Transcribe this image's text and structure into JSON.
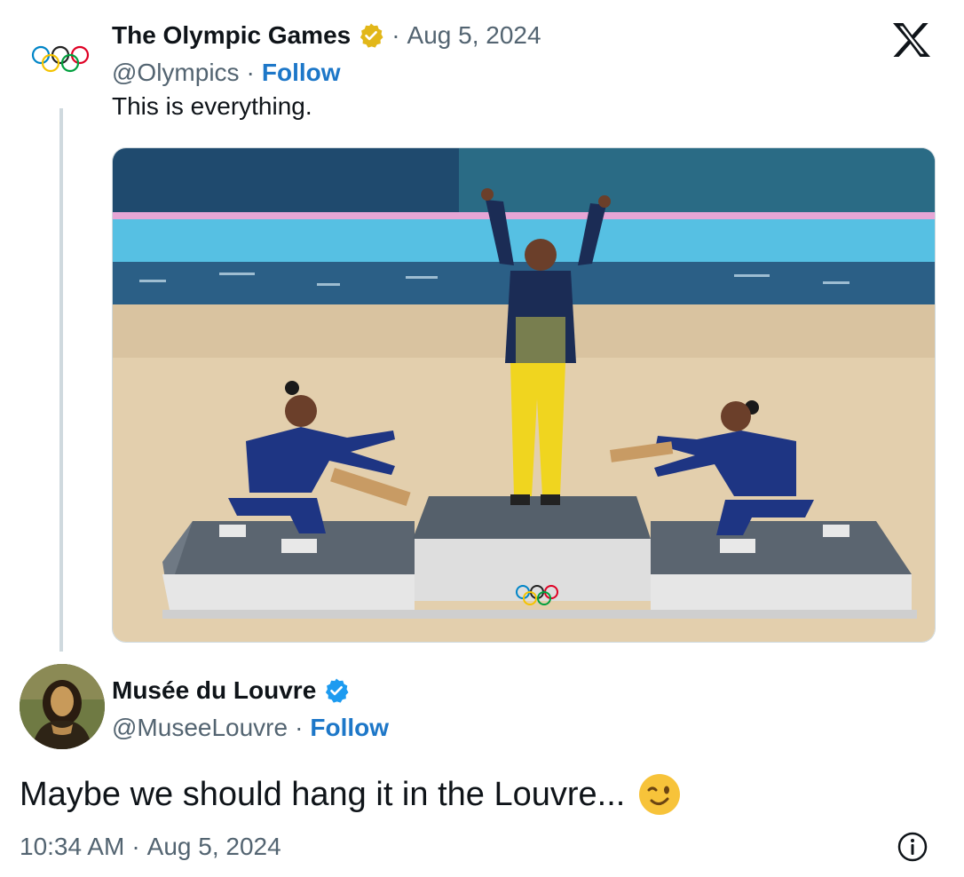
{
  "first_tweet": {
    "author_name": "The Olympic Games",
    "handle": "@Olympics",
    "separator": "·",
    "date": "Aug 5, 2024",
    "follow_label": "Follow",
    "text": "This is everything.",
    "verified_badge_color": "#e2b719",
    "avatar_icon": "olympic-rings-icon",
    "media_icon": "photo"
  },
  "reply_tweet": {
    "author_name": "Musée du Louvre",
    "handle": "@MuseeLouvre",
    "separator": "·",
    "follow_label": "Follow",
    "text": "Maybe we should hang it in the Louvre...",
    "emoji": "😉",
    "verified_badge_color": "#1d9bf0",
    "time": "10:34 AM",
    "date": "Aug 5, 2024",
    "avatar_icon": "mona-lisa-avatar"
  },
  "brand": {
    "logo": "x-logo-icon"
  },
  "colors": {
    "link": "#1d77c8",
    "muted": "#536471",
    "text": "#0f1419"
  }
}
